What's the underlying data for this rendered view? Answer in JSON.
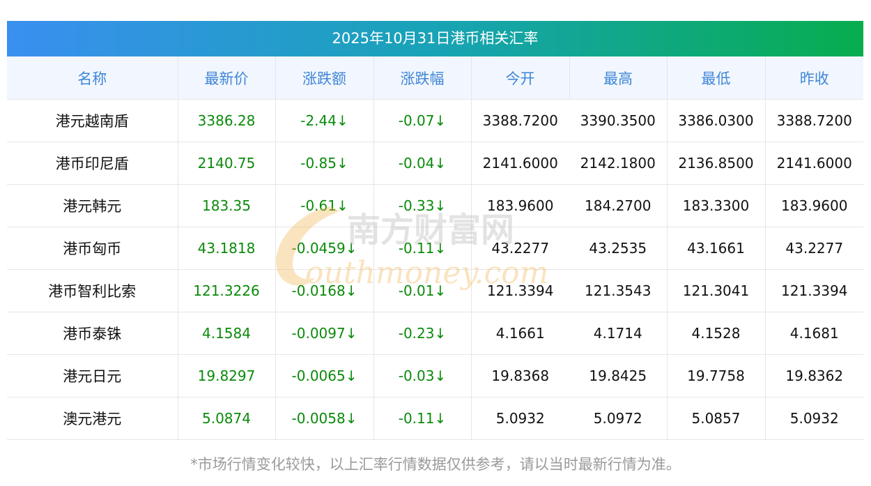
{
  "title": "2025年10月31日港币相关汇率",
  "columns": [
    "名称",
    "最新价",
    "涨跌额",
    "涨跌幅",
    "今开",
    "最高",
    "最低",
    "昨收"
  ],
  "rows": [
    [
      "港元越南盾",
      "3386.28",
      "-2.44↓",
      "-0.07↓",
      "3388.7200",
      "3390.3500",
      "3386.0300",
      "3388.7200"
    ],
    [
      "港币印尼盾",
      "2140.75",
      "-0.85↓",
      "-0.04↓",
      "2141.6000",
      "2142.1800",
      "2136.8500",
      "2141.6000"
    ],
    [
      "港元韩元",
      "183.35",
      "-0.61↓",
      "-0.33↓",
      "183.9600",
      "184.2700",
      "183.3300",
      "183.9600"
    ],
    [
      "港币匈币",
      "43.1818",
      "-0.0459↓",
      "-0.11↓",
      "43.2277",
      "43.2535",
      "43.1661",
      "43.2277"
    ],
    [
      "港币智利比索",
      "121.3226",
      "-0.0168↓",
      "-0.01↓",
      "121.3394",
      "121.3543",
      "121.3041",
      "121.3394"
    ],
    [
      "港币泰铢",
      "4.1584",
      "-0.0097↓",
      "-0.23↓",
      "4.1661",
      "4.1714",
      "4.1528",
      "4.1681"
    ],
    [
      "港元日元",
      "19.8297",
      "-0.0065↓",
      "-0.03↓",
      "19.8368",
      "19.8425",
      "19.7758",
      "19.8362"
    ],
    [
      "澳元港元",
      "5.0874",
      "-0.0058↓",
      "-0.11↓",
      "5.0932",
      "5.0972",
      "5.0857",
      "5.0932"
    ]
  ],
  "disclaimer": "*市场行情变化较快，以上汇率行情数据仅供参考，请以当时最新行情为准。",
  "watermark": {
    "cn": "南方财富网",
    "en": "outhmoney.com"
  },
  "colors": {
    "down": "#0a8a0a",
    "header_text": "#3f86d6",
    "header_bg": "#f2f7ff",
    "grad_start": "#3a8ff0",
    "grad_end": "#07ad4e"
  }
}
